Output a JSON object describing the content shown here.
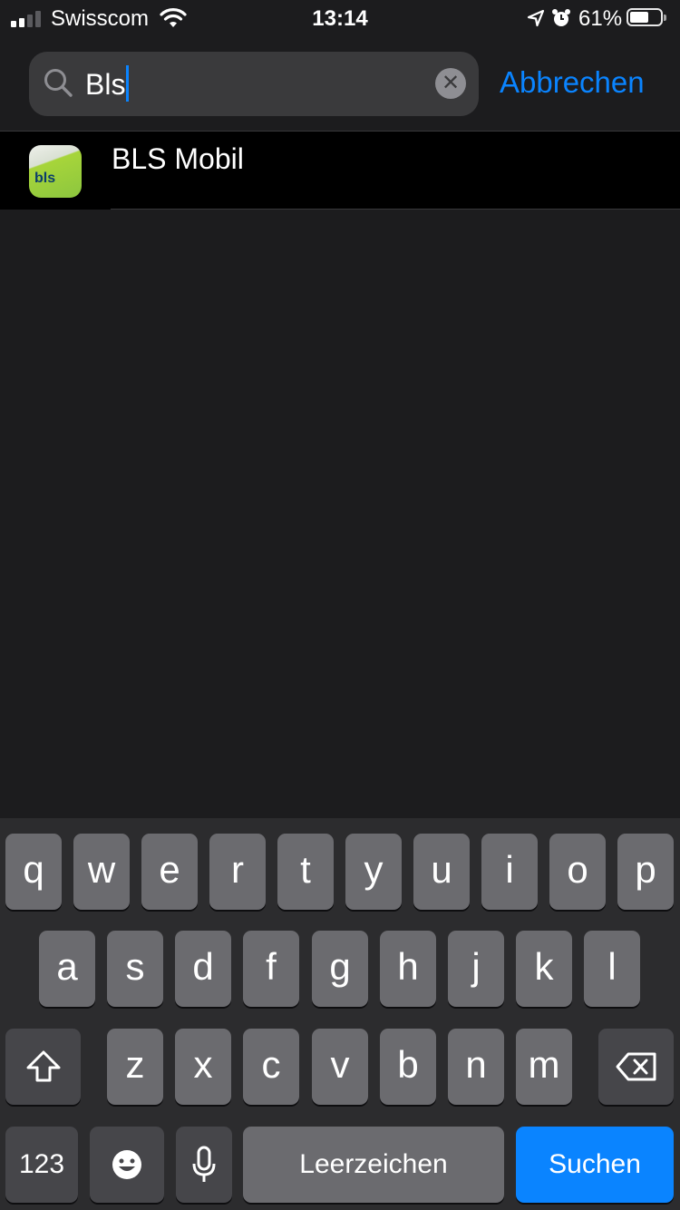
{
  "status_bar": {
    "carrier": "Swisscom",
    "time": "13:14",
    "battery_percent": "61%",
    "battery_level": 0.61,
    "signal_bars_active": 2,
    "signal_bars_total": 4,
    "icons": [
      "signal-icon",
      "wifi-icon",
      "location-icon",
      "alarm-icon",
      "battery-icon"
    ]
  },
  "search": {
    "value": "Bls",
    "clear_icon": "clear-icon",
    "cancel_label": "Abbrechen"
  },
  "results": [
    {
      "title": "BLS Mobil",
      "icon": "bls-app-icon",
      "icon_text": "bls"
    }
  ],
  "keyboard": {
    "row1": [
      "q",
      "w",
      "e",
      "r",
      "t",
      "y",
      "u",
      "i",
      "o",
      "p"
    ],
    "row2": [
      "a",
      "s",
      "d",
      "f",
      "g",
      "h",
      "j",
      "k",
      "l"
    ],
    "row3": [
      "z",
      "x",
      "c",
      "v",
      "b",
      "n",
      "m"
    ],
    "numbers_label": "123",
    "space_label": "Leerzeichen",
    "search_label": "Suchen",
    "shift_icon": "shift-icon",
    "delete_icon": "delete-icon",
    "emoji_icon": "emoji-icon",
    "mic_icon": "microphone-icon"
  },
  "colors": {
    "background": "#1c1c1e",
    "accent": "#0a84ff",
    "key": "#6b6b6f",
    "key_dark": "#46464a"
  }
}
